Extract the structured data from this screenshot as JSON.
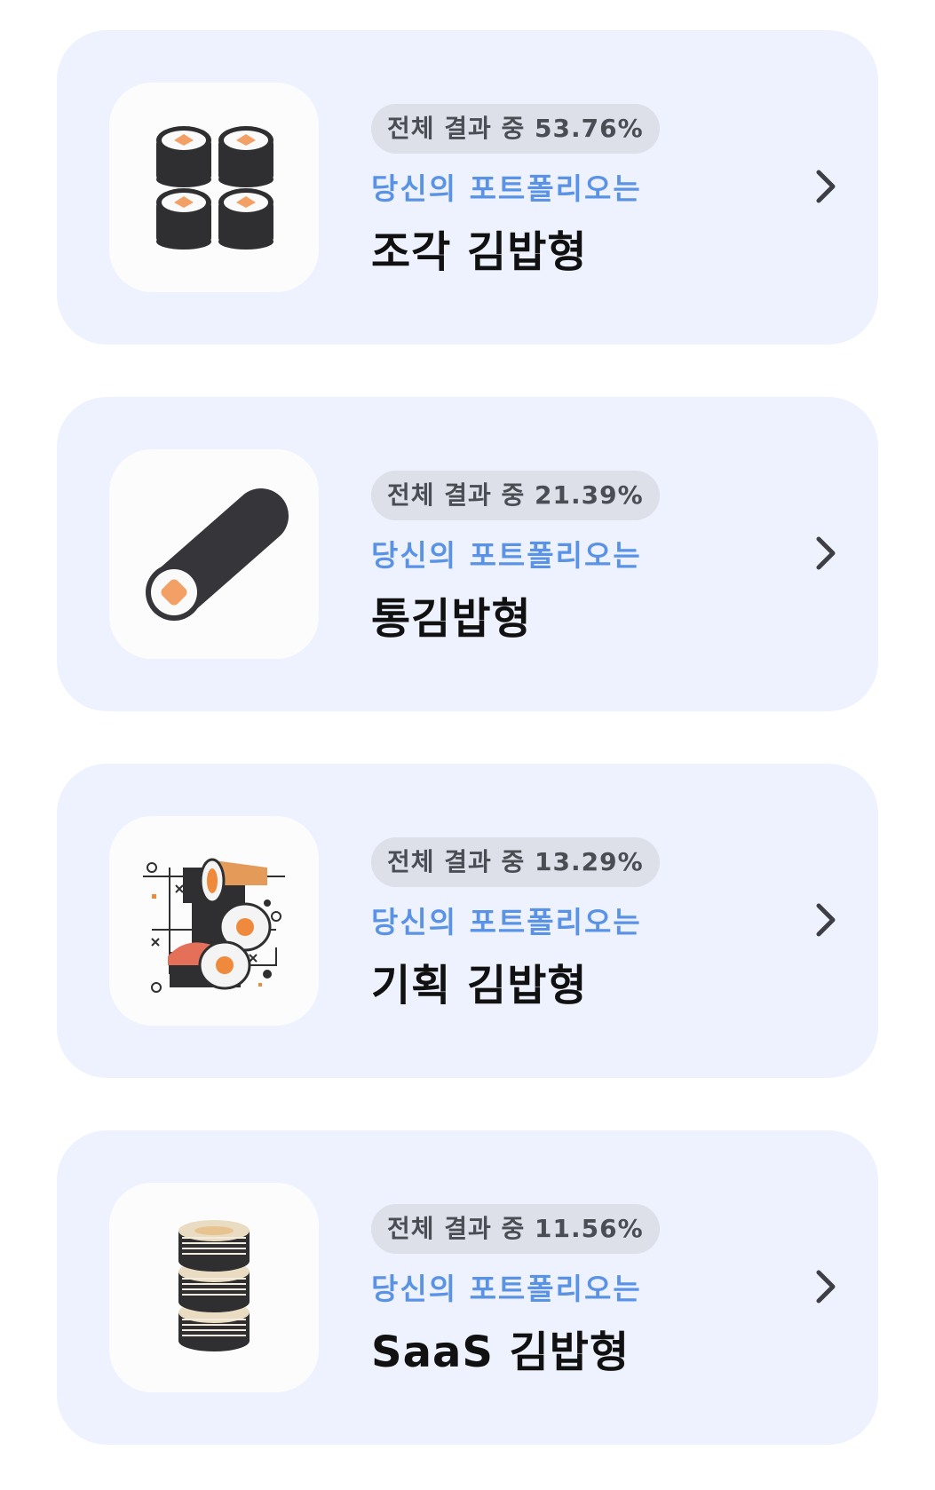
{
  "results": [
    {
      "badge": "전체 결과 중 53.76%",
      "subtitle": "당신의 포트폴리오는",
      "title": "조각 김밥형",
      "icon": "sliced-kimbap-icon"
    },
    {
      "badge": "전체 결과 중 21.39%",
      "subtitle": "당신의 포트폴리오는",
      "title": "통김밥형",
      "icon": "whole-kimbap-roll-icon"
    },
    {
      "badge": "전체 결과 중 13.29%",
      "subtitle": "당신의 포트폴리오는",
      "title": "기획 김밥형",
      "icon": "planned-kimbap-illustration-icon"
    },
    {
      "badge": "전체 결과 중 11.56%",
      "subtitle": "당신의 포트폴리오는",
      "title": "SaaS 김밥형",
      "icon": "stacked-kimbap-icon"
    }
  ],
  "colors": {
    "card_bg": "#eef2fe",
    "badge_bg": "#dde0e8",
    "subtitle": "#5a93e6",
    "title": "#111111"
  }
}
